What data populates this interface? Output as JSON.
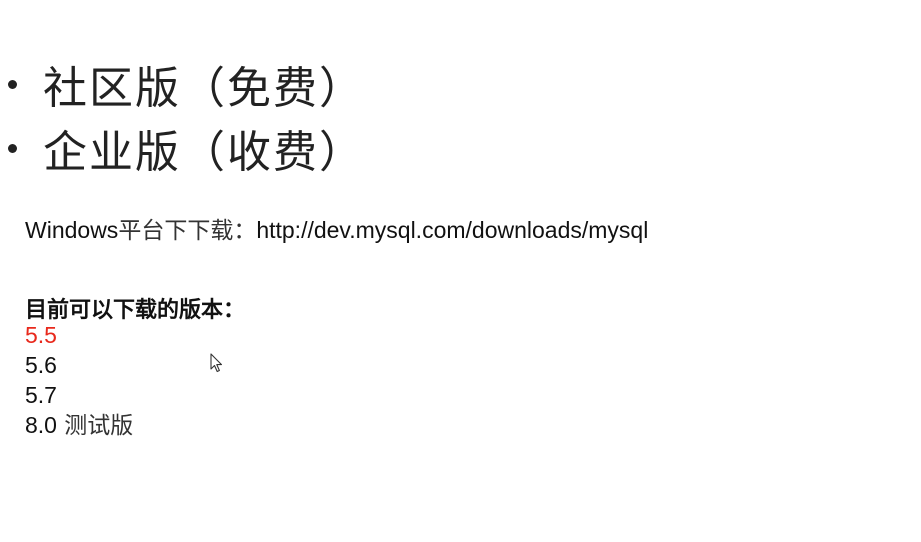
{
  "editions": [
    {
      "label": "社区版（免费）"
    },
    {
      "label": "企业版（收费）"
    }
  ],
  "download": {
    "platform_label": "Windows",
    "label_suffix": "平台下下载：",
    "url": "http://dev.mysql.com/downloads/mysql"
  },
  "versions": {
    "heading": "目前可以下载的版本：",
    "highlight_color": "#e8291c",
    "items": [
      {
        "version": "5.5",
        "note": "",
        "highlighted": true
      },
      {
        "version": "5.6",
        "note": "",
        "highlighted": false
      },
      {
        "version": "5.7",
        "note": "",
        "highlighted": false
      },
      {
        "version": "8.0",
        "note": " 测试版",
        "highlighted": false
      }
    ]
  },
  "cursor": {
    "icon": "mouse-pointer-icon"
  }
}
